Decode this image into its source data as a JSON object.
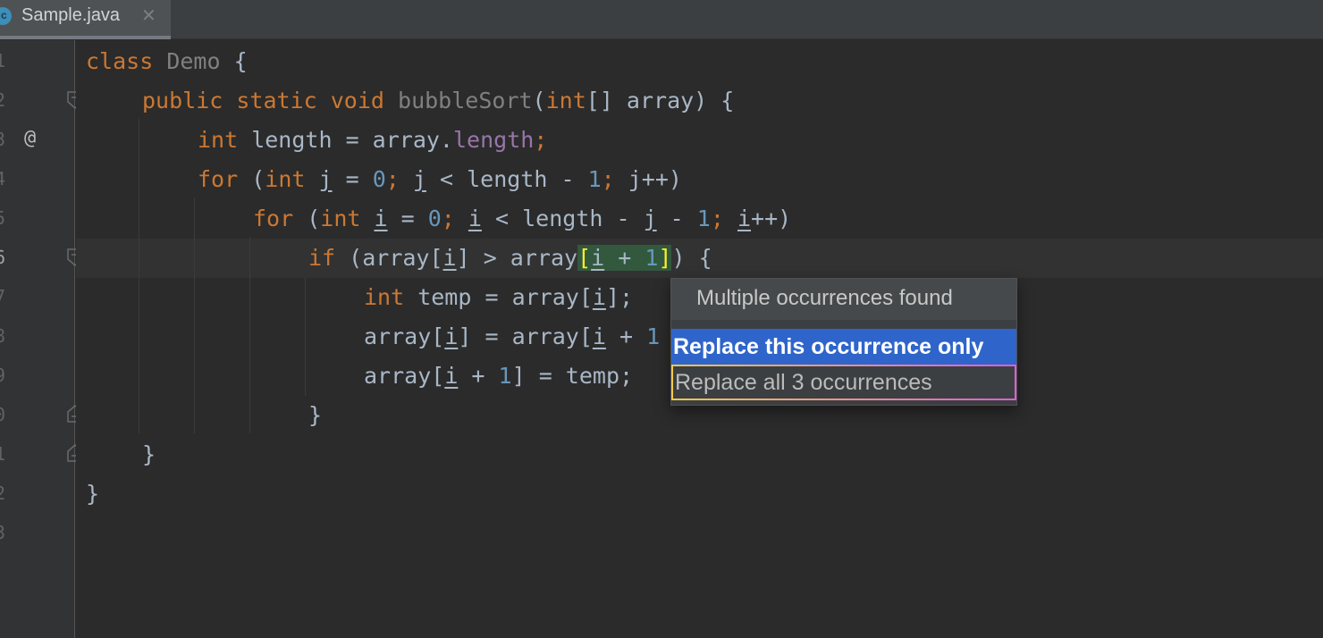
{
  "tab": {
    "label": "Sample.java",
    "icon": "c",
    "close": "✕"
  },
  "gutter": {
    "line_numbers": [
      "1",
      "2",
      "3",
      "4",
      "5",
      "6",
      "7",
      "8",
      "9",
      "0",
      "1",
      "2",
      "3"
    ],
    "annotation": "@"
  },
  "code": {
    "l1": [
      "class",
      " ",
      "Demo",
      " {"
    ],
    "l2": [
      "public",
      " ",
      "static",
      " ",
      "void",
      " ",
      "bubbleSort",
      "(",
      "int",
      "[] array) {"
    ],
    "l3": [
      "int",
      " length = array.",
      "length",
      ";"
    ],
    "l4": [
      "for",
      " (",
      "int",
      " ",
      "j",
      " = ",
      "0",
      "; ",
      "j",
      " < length - ",
      "1",
      "; ",
      "j",
      "++)"
    ],
    "l5": [
      "for",
      " (",
      "int",
      " ",
      "i",
      " = ",
      "0",
      "; ",
      "i",
      " < length - ",
      "j",
      " - ",
      "1",
      "; ",
      "i",
      "++)"
    ],
    "l6": [
      "if",
      " (array[",
      "i",
      "] > array",
      "[",
      "i",
      " + ",
      "1",
      "]",
      ") {"
    ],
    "l7": [
      "int",
      " temp = array[",
      "i",
      "];"
    ],
    "l8": [
      "array[",
      "i",
      "] = array[",
      "i",
      " + ",
      "1"
    ],
    "l9": [
      "array[",
      "i",
      " + ",
      "1",
      "] = temp;"
    ],
    "l10": [
      "}"
    ],
    "l11": [
      "}"
    ],
    "l12": [
      "}"
    ]
  },
  "popup": {
    "title": "Multiple occurrences found",
    "options": [
      "Replace this occurrence only",
      "Replace all 3 occurrences"
    ]
  },
  "colors": {
    "keyword": "#cc7832",
    "number": "#6897bb",
    "field": "#9876aa",
    "text": "#a9b7c6",
    "selection": "#2f65ca"
  }
}
